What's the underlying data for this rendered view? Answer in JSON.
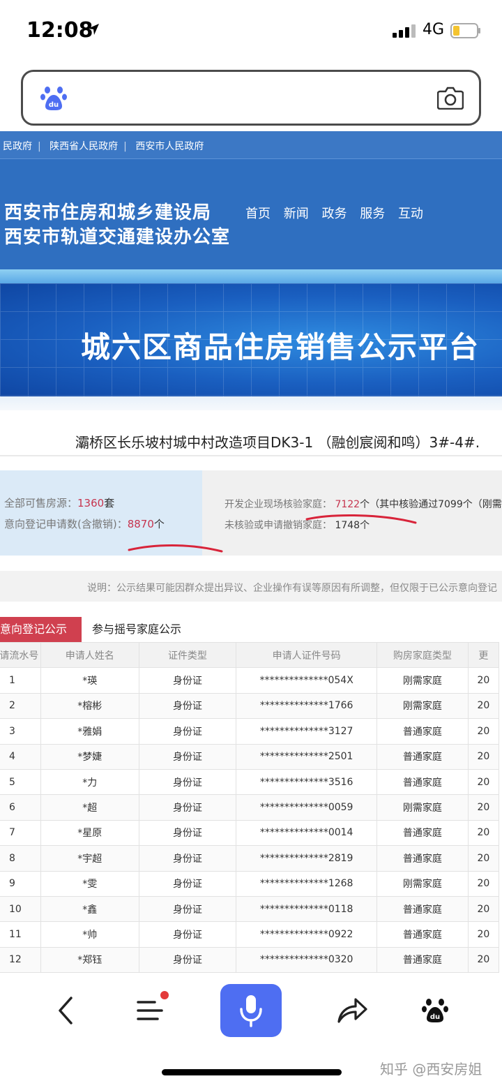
{
  "status_bar": {
    "time": "12:08",
    "network": "4G"
  },
  "gov_header": {
    "links": [
      "民政府",
      "陕西省人民政府",
      "西安市人民政府"
    ],
    "org_name_1": "西安市住房和城乡建设局",
    "org_name_2": "西安市轨道交通建设办公室",
    "nav": [
      "首页",
      "新闻",
      "政务",
      "服务",
      "互动"
    ]
  },
  "banner_title": "城六区商品住房销售公示平台",
  "project_title": "灞桥区长乐坡村城中村改造项目DK3-1 （融创宸阅和鸣）3#-4#.",
  "stats": {
    "available_label": "全部可售房源：",
    "available_value": "1360",
    "available_unit": "套",
    "applications_label": "意向登记申请数(含撤销)：",
    "applications_value": "8870",
    "applications_unit": "个",
    "verified_label": "开发企业现场核验家庭：",
    "verified_value": "7122",
    "verified_suffix": "个（其中核验通过7099个（刚需",
    "unverified_label": "未核验或申请撤销家庭：",
    "unverified_value": "1748个"
  },
  "note": "说明：公示结果可能因群众提出异议、企业操作有误等原因有所调整，但仅限于已公示意向登记",
  "tabs": [
    "意向登记公示",
    "参与摇号家庭公示"
  ],
  "table": {
    "headers": [
      "请流水号",
      "申请人姓名",
      "证件类型",
      "申请人证件号码",
      "购房家庭类型",
      "更"
    ],
    "rows": [
      [
        "1",
        "*瑛",
        "身份证",
        "**************054X",
        "刚需家庭",
        "20"
      ],
      [
        "2",
        "*榕彬",
        "身份证",
        "**************1766",
        "刚需家庭",
        "20"
      ],
      [
        "3",
        "*雅娟",
        "身份证",
        "**************3127",
        "普通家庭",
        "20"
      ],
      [
        "4",
        "*梦婕",
        "身份证",
        "**************2501",
        "普通家庭",
        "20"
      ],
      [
        "5",
        "*力",
        "身份证",
        "**************3516",
        "普通家庭",
        "20"
      ],
      [
        "6",
        "*超",
        "身份证",
        "**************0059",
        "刚需家庭",
        "20"
      ],
      [
        "7",
        "*星原",
        "身份证",
        "**************0014",
        "普通家庭",
        "20"
      ],
      [
        "8",
        "*宇超",
        "身份证",
        "**************2819",
        "普通家庭",
        "20"
      ],
      [
        "9",
        "*雯",
        "身份证",
        "**************1268",
        "刚需家庭",
        "20"
      ],
      [
        "10",
        "*鑫",
        "身份证",
        "**************0118",
        "普通家庭",
        "20"
      ],
      [
        "11",
        "*帅",
        "身份证",
        "**************0922",
        "普通家庭",
        "20"
      ],
      [
        "12",
        "*郑钰",
        "身份证",
        "**************0320",
        "普通家庭",
        "20"
      ]
    ]
  },
  "bottom_bar": {
    "icons": [
      "back-icon",
      "menu-icon",
      "microphone-icon",
      "share-icon",
      "baidu-paw-icon"
    ],
    "watermark": "知乎 @西安房姐"
  },
  "colors": {
    "accent_red": "#c6344e",
    "baidu_blue": "#4e6ef2",
    "gov_blue": "#2f6fc0"
  }
}
